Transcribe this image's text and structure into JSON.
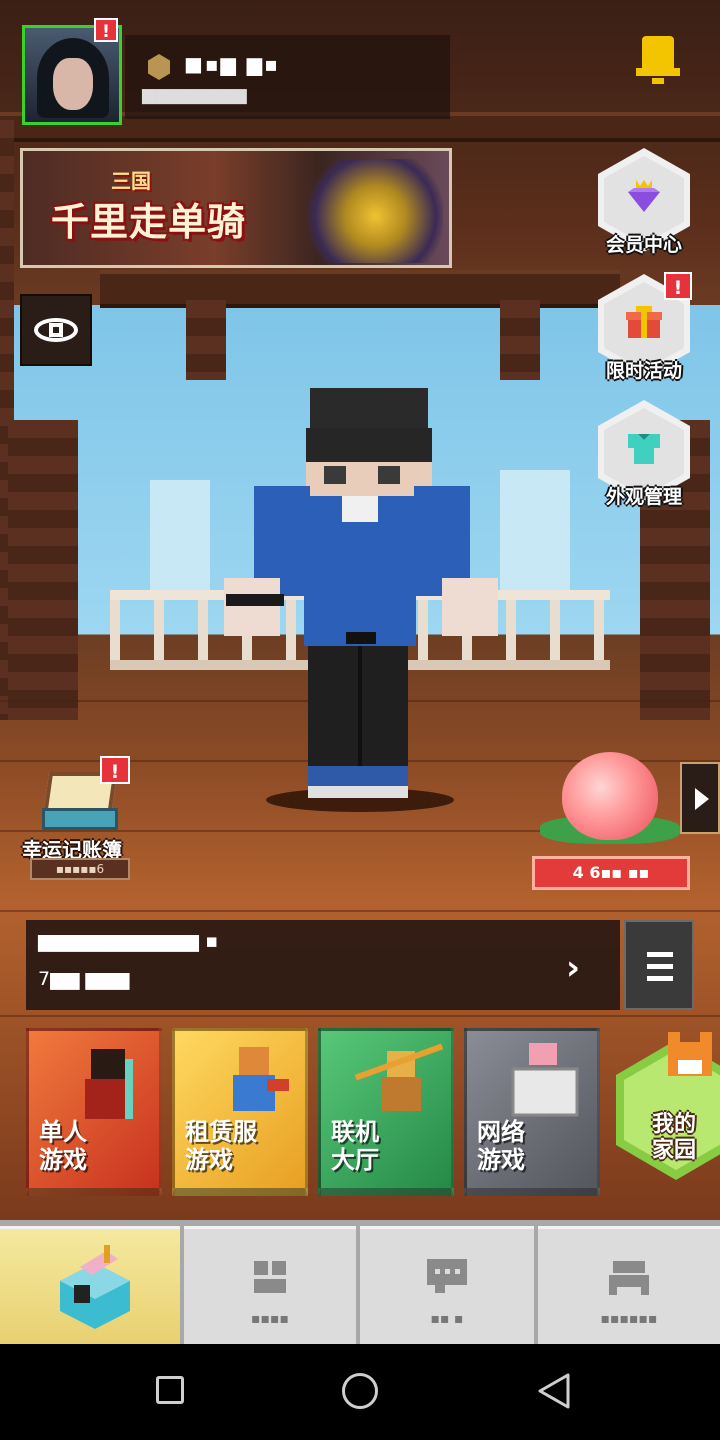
{
  "profile": {
    "avatar_alert": "!",
    "player_name": "■▪▆ ▆▪",
    "player_id": "▆▆▆▆▆▆▆▆"
  },
  "banner": {
    "subtitle": "三国",
    "title": "千里走单骑"
  },
  "right_menu": [
    {
      "label": "会员中心",
      "icon": "diamond-crown-icon",
      "alert": ""
    },
    {
      "label": "限时活动",
      "icon": "gift-icon",
      "alert": "!"
    },
    {
      "label": "外观管理",
      "icon": "armor-icon",
      "alert": ""
    }
  ],
  "ledger": {
    "label": "幸运记账簿",
    "alert": "!",
    "count": "▪▪▪▪▪6"
  },
  "peach": {
    "value": "4  6▪▪ ▪▪"
  },
  "info_bar": {
    "line1": "▆▆▆▆▆▆▆▆▆▆▆ ▪",
    "line2": "7▆▆ ▆▆▆",
    "chevron": "›"
  },
  "modes": [
    {
      "label": "单人\n游戏",
      "color": "#d9532b"
    },
    {
      "label": "租赁服\n游戏",
      "color": "#efb52f"
    },
    {
      "label": "联机\n大厅",
      "color": "#3aa35c"
    },
    {
      "label": "网络\n游戏",
      "color": "#70727c"
    }
  ],
  "home": {
    "label": "我的\n家园"
  },
  "tabs": [
    {
      "label": "",
      "icon": "shop-icon",
      "active": true
    },
    {
      "label": "▪▪▪▪",
      "icon": "cube-icon",
      "active": false
    },
    {
      "label": "▪▪ ▪",
      "icon": "chat-icon",
      "active": false
    },
    {
      "label": "▪▪▪▪▪▪",
      "icon": "bed-icon",
      "active": false
    }
  ],
  "colors": {
    "accent_green": "#38d22a",
    "alert_red": "#e8323b",
    "bell_yellow": "#f3c400"
  }
}
